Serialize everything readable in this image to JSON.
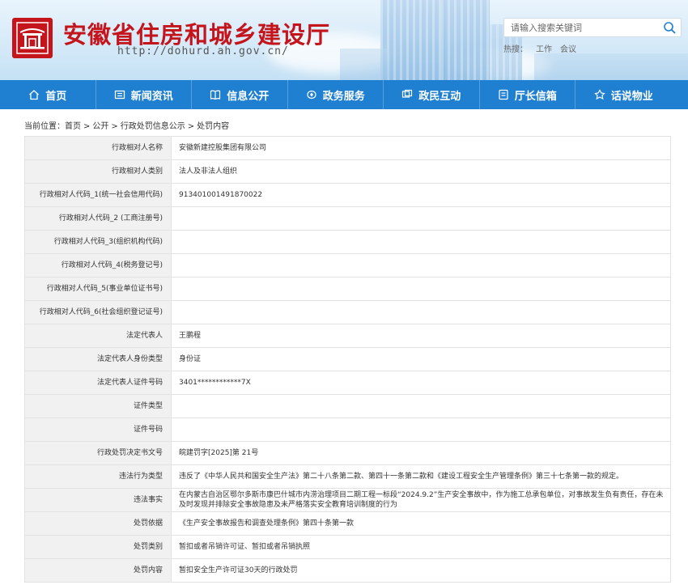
{
  "site": {
    "title": "安徽省住房和城乡建设厅",
    "url": "http://dohurd.ah.gov.cn/"
  },
  "search": {
    "placeholder": "请输入搜索关键词",
    "hot_label": "热搜：",
    "hot_words": [
      "工作",
      "会议"
    ]
  },
  "nav": [
    {
      "label": "首页",
      "icon": "home-icon"
    },
    {
      "label": "新闻资讯",
      "icon": "news-icon"
    },
    {
      "label": "信息公开",
      "icon": "book-icon"
    },
    {
      "label": "政务服务",
      "icon": "service-icon"
    },
    {
      "label": "政民互动",
      "icon": "interaction-icon"
    },
    {
      "label": "厅长信箱",
      "icon": "mailbox-icon"
    },
    {
      "label": "话说物业",
      "icon": "property-icon"
    }
  ],
  "breadcrumb": {
    "prefix": "当前位置：",
    "items": [
      "首页",
      "公开",
      "行政处罚信息公示",
      "处罚内容"
    ],
    "sep": ">"
  },
  "record": [
    {
      "key": "行政相对人名称",
      "value": "安徽新建控股集团有限公司"
    },
    {
      "key": "行政相对人类别",
      "value": "法人及非法人组织"
    },
    {
      "key": "行政相对人代码_1(统一社会信用代码)",
      "value": "913401001491870022"
    },
    {
      "key": "行政相对人代码_2 (工商注册号)",
      "value": ""
    },
    {
      "key": "行政相对人代码_3(组织机构代码)",
      "value": ""
    },
    {
      "key": "行政相对人代码_4(税务登记号)",
      "value": ""
    },
    {
      "key": "行政相对人代码_5(事业单位证书号)",
      "value": ""
    },
    {
      "key": "行政相对人代码_6(社会组织登记证号)",
      "value": ""
    },
    {
      "key": "法定代表人",
      "value": "王鹏程"
    },
    {
      "key": "法定代表人身份类型",
      "value": "身份证"
    },
    {
      "key": "法定代表人证件号码",
      "value": "3401************7X"
    },
    {
      "key": "证件类型",
      "value": ""
    },
    {
      "key": "证件号码",
      "value": ""
    },
    {
      "key": "行政处罚决定书文号",
      "value": "皖建罚字[2025]第 21号"
    },
    {
      "key": "违法行为类型",
      "value": "违反了《中华人民共和国安全生产法》第二十八条第二款、第四十一条第二款和《建设工程安全生产管理条例》第三十七条第一款的规定。"
    },
    {
      "key": "违法事实",
      "value": "在内蒙古自治区鄂尔多斯市康巴什城市内涝治理项目二期工程一标段“2024.9.2”生产安全事故中，作为施工总承包单位，对事故发生负有责任，存在未及时发现并排除安全事故隐患及未严格落实安全教育培训制度的行为"
    },
    {
      "key": "处罚依据",
      "value": "《生产安全事故报告和调查处理条例》第四十条第一款"
    },
    {
      "key": "处罚类别",
      "value": "暂扣或者吊销许可证、暂扣或者吊销执照"
    },
    {
      "key": "处罚内容",
      "value": "暂扣安全生产许可证30天的行政处罚"
    }
  ]
}
